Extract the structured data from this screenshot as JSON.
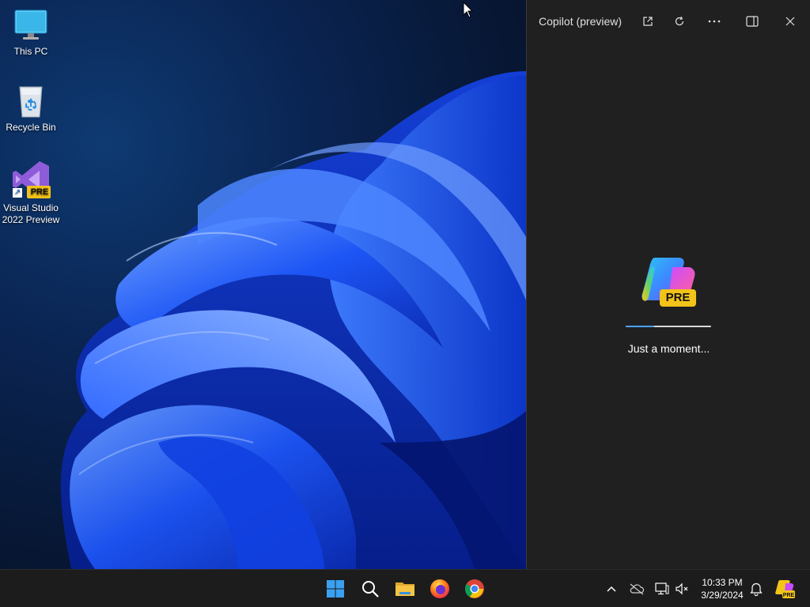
{
  "desktop": {
    "icons": [
      {
        "label": "This PC",
        "icon": "monitor-icon"
      },
      {
        "label": "Recycle Bin",
        "icon": "recycle-bin-icon"
      },
      {
        "label_line1": "Visual Studio",
        "label_line2": "2022 Preview",
        "badge": "PRE",
        "icon": "visual-studio-icon"
      }
    ]
  },
  "copilot": {
    "title": "Copilot (preview)",
    "buttons": [
      "open-external-icon",
      "refresh-icon",
      "more-icon",
      "dock-icon",
      "close-icon"
    ],
    "logo_badge": "PRE",
    "status": "Just a moment...",
    "progress": 0.33
  },
  "taskbar": {
    "apps": [
      "windows-start-icon",
      "search-icon",
      "file-explorer-icon",
      "firefox-icon",
      "chrome-icon"
    ],
    "tray": [
      "chevron-up-icon",
      "cloud-offline-icon",
      "network-icon",
      "volume-muted-icon",
      "notifications-icon",
      "copilot-icon"
    ],
    "time": "10:33 PM",
    "date": "3/29/2024"
  },
  "colors": {
    "wallpaper_blue": "#1f5cff",
    "panel_bg": "#202020",
    "taskbar_bg": "#1c1c1c",
    "progress_accent": "#4aa3ff",
    "pre_badge": "#f2c318"
  }
}
